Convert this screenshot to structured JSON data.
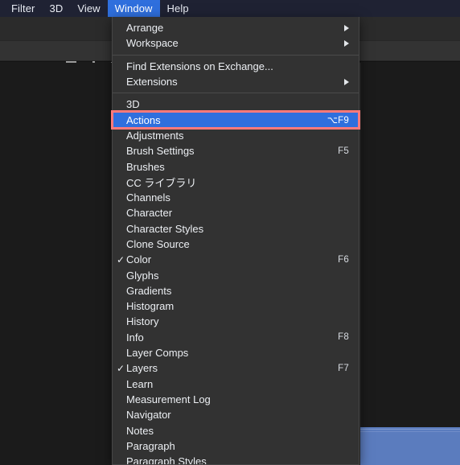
{
  "menubar": {
    "items": [
      {
        "label": "Filter",
        "active": false
      },
      {
        "label": "3D",
        "active": false
      },
      {
        "label": "View",
        "active": false
      },
      {
        "label": "Window",
        "active": true
      },
      {
        "label": "Help",
        "active": false
      }
    ]
  },
  "dropdown": {
    "title": "Window",
    "groups": [
      {
        "items": [
          {
            "label": "Arrange",
            "shortcut": "",
            "submenu": true,
            "checked": false,
            "selected": false
          },
          {
            "label": "Workspace",
            "shortcut": "",
            "submenu": true,
            "checked": false,
            "selected": false
          }
        ]
      },
      {
        "items": [
          {
            "label": "Find Extensions on Exchange...",
            "shortcut": "",
            "submenu": false,
            "checked": false,
            "selected": false
          },
          {
            "label": "Extensions",
            "shortcut": "",
            "submenu": true,
            "checked": false,
            "selected": false
          }
        ]
      },
      {
        "items": [
          {
            "label": "3D",
            "shortcut": "",
            "submenu": false,
            "checked": false,
            "selected": false
          },
          {
            "label": "Actions",
            "shortcut": "⌥F9",
            "submenu": false,
            "checked": false,
            "selected": true
          },
          {
            "label": "Adjustments",
            "shortcut": "",
            "submenu": false,
            "checked": false,
            "selected": false
          },
          {
            "label": "Brush Settings",
            "shortcut": "F5",
            "submenu": false,
            "checked": false,
            "selected": false
          },
          {
            "label": "Brushes",
            "shortcut": "",
            "submenu": false,
            "checked": false,
            "selected": false
          },
          {
            "label": "CC ライブラリ",
            "shortcut": "",
            "submenu": false,
            "checked": false,
            "selected": false
          },
          {
            "label": "Channels",
            "shortcut": "",
            "submenu": false,
            "checked": false,
            "selected": false
          },
          {
            "label": "Character",
            "shortcut": "",
            "submenu": false,
            "checked": false,
            "selected": false
          },
          {
            "label": "Character Styles",
            "shortcut": "",
            "submenu": false,
            "checked": false,
            "selected": false
          },
          {
            "label": "Clone Source",
            "shortcut": "",
            "submenu": false,
            "checked": false,
            "selected": false
          },
          {
            "label": "Color",
            "shortcut": "F6",
            "submenu": false,
            "checked": true,
            "selected": false
          },
          {
            "label": "Glyphs",
            "shortcut": "",
            "submenu": false,
            "checked": false,
            "selected": false
          },
          {
            "label": "Gradients",
            "shortcut": "",
            "submenu": false,
            "checked": false,
            "selected": false
          },
          {
            "label": "Histogram",
            "shortcut": "",
            "submenu": false,
            "checked": false,
            "selected": false
          },
          {
            "label": "History",
            "shortcut": "",
            "submenu": false,
            "checked": false,
            "selected": false
          },
          {
            "label": "Info",
            "shortcut": "F8",
            "submenu": false,
            "checked": false,
            "selected": false
          },
          {
            "label": "Layer Comps",
            "shortcut": "",
            "submenu": false,
            "checked": false,
            "selected": false
          },
          {
            "label": "Layers",
            "shortcut": "F7",
            "submenu": false,
            "checked": true,
            "selected": false
          },
          {
            "label": "Learn",
            "shortcut": "",
            "submenu": false,
            "checked": false,
            "selected": false
          },
          {
            "label": "Measurement Log",
            "shortcut": "",
            "submenu": false,
            "checked": false,
            "selected": false
          },
          {
            "label": "Navigator",
            "shortcut": "",
            "submenu": false,
            "checked": false,
            "selected": false
          },
          {
            "label": "Notes",
            "shortcut": "",
            "submenu": false,
            "checked": false,
            "selected": false
          },
          {
            "label": "Paragraph",
            "shortcut": "",
            "submenu": false,
            "checked": false,
            "selected": false
          },
          {
            "label": "Paragraph Styles",
            "shortcut": "",
            "submenu": false,
            "checked": false,
            "selected": false
          }
        ]
      }
    ]
  },
  "annotation": {
    "target_label": "Actions",
    "border_color": "#ff7a7a"
  },
  "colors": {
    "menubar_bg": "#1f2233",
    "highlight_blue": "#2f6fdd",
    "menu_bg": "#323232",
    "app_bg": "#1c1c1c",
    "image_blue": "#5b7cbe"
  },
  "icons": {
    "checkmark": "✓",
    "submenu_arrow": "submenu-arrow-icon",
    "align_tools": [
      "align-left-icon",
      "align-horizontal-center-icon",
      "align-right-icon",
      "align-top-icon",
      "align-vertical-center-icon",
      "align-bottom-icon"
    ]
  }
}
